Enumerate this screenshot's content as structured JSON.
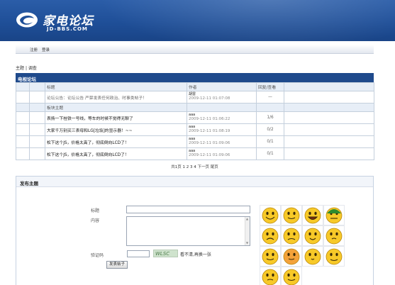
{
  "header": {
    "logo_name": "家电论坛",
    "logo_domain": "JD-BBS.COM",
    "logo_icon": "swirl-logo-icon",
    "brand_color": "#1f4f98"
  },
  "nav": {
    "register": "注册",
    "login": "登录"
  },
  "breadcrumb": {
    "home": "主题",
    "sep": "|",
    "current": "调查"
  },
  "forum": {
    "title": "电视论坛",
    "columns": [
      "标题",
      "作者",
      "回复/查看"
    ],
    "notice": {
      "title": "论坛公告：论坛公告 严禁发表任何政治、时事类帖子！",
      "author": "胡雷",
      "time": "2009-12-11 01:07:08",
      "count": "—"
    },
    "section_label": "板块主题",
    "threads": [
      {
        "title": "表扬一下桂铁一号线，等车的时候不觉得无聊了",
        "author": "aaa",
        "time": "2009-12-11 01:06:22",
        "count": "1/6"
      },
      {
        "title": "大家千万别买三表母和LG[垃圾]的显示器！~~",
        "author": "aaa",
        "time": "2009-12-11 01:08:19",
        "count": "0/2"
      },
      {
        "title": "松下这个JS，价格太高了，彻底倒向LCD了！",
        "author": "aaa",
        "time": "2009-12-11 01:09:06",
        "count": "0/1"
      },
      {
        "title": "松下这个JS，价格太高了，彻底倒向LCD了！",
        "author": "aaa",
        "time": "2009-12-11 01:09:06",
        "count": "0/1"
      }
    ],
    "pager": "共1页 1 2 3 4 下一页 尾页"
  },
  "post": {
    "title": "发布主题",
    "label_title": "标题",
    "label_content": "内容",
    "label_code": "验证码",
    "captcha_text": "WLSC",
    "captcha_hint": "看不清,再换一张",
    "submit_label": "发表帖子",
    "smileys": [
      "grin-icon",
      "wink-icon",
      "laugh-icon",
      "cap-icon",
      "cry-icon",
      "angry-icon",
      "tongue-icon",
      "scared-icon",
      "sweat-icon",
      "shy-icon",
      "kiss-icon",
      "fire-icon",
      "dizzy-icon",
      "cool-icon"
    ]
  }
}
